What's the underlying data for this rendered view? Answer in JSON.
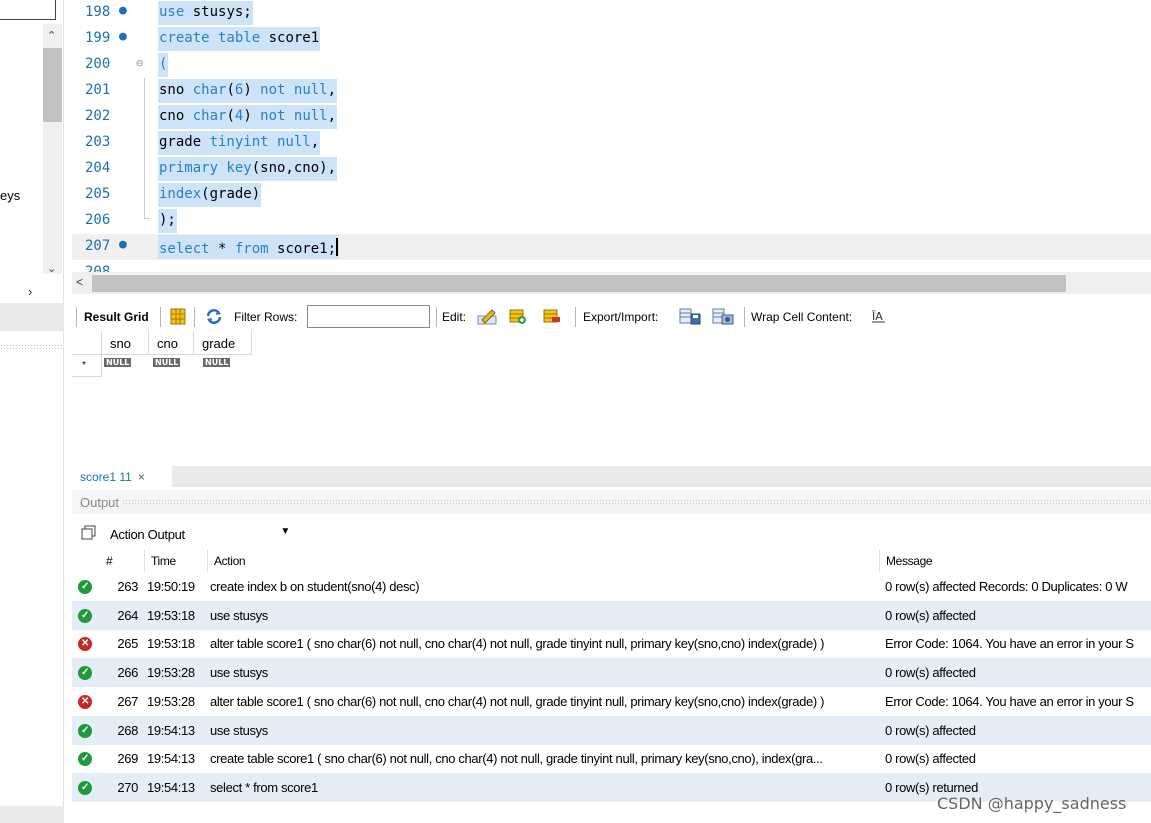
{
  "left_panel": {
    "partial_label": "eys",
    "expand_arrow": "›"
  },
  "editor": {
    "lines": [
      {
        "num": "198",
        "marker": "●",
        "fold": "",
        "code": [
          {
            "t": "use",
            "k": true
          },
          {
            "t": " stusys;",
            "k": false
          }
        ]
      },
      {
        "num": "199",
        "marker": "●",
        "fold": "",
        "code": [
          {
            "t": "create table",
            "k": true
          },
          {
            "t": " score1",
            "k": false
          }
        ]
      },
      {
        "num": "200",
        "marker": "",
        "fold": "⊖",
        "code": [
          {
            "t": "(",
            "k": true
          }
        ]
      },
      {
        "num": "201",
        "marker": "",
        "fold": "",
        "code": [
          {
            "t": "sno ",
            "k": false
          },
          {
            "t": "char",
            "k": true
          },
          {
            "t": "(",
            "k": false
          },
          {
            "t": "6",
            "k": true
          },
          {
            "t": ") ",
            "k": false
          },
          {
            "t": "not null",
            "k": true
          },
          {
            "t": ",",
            "k": false
          }
        ]
      },
      {
        "num": "202",
        "marker": "",
        "fold": "",
        "code": [
          {
            "t": "cno ",
            "k": false
          },
          {
            "t": "char",
            "k": true
          },
          {
            "t": "(",
            "k": false
          },
          {
            "t": "4",
            "k": true
          },
          {
            "t": ") ",
            "k": false
          },
          {
            "t": "not null",
            "k": true
          },
          {
            "t": ",",
            "k": false
          }
        ]
      },
      {
        "num": "203",
        "marker": "",
        "fold": "",
        "code": [
          {
            "t": "grade ",
            "k": false
          },
          {
            "t": "tinyint null",
            "k": true
          },
          {
            "t": ",",
            "k": false
          }
        ]
      },
      {
        "num": "204",
        "marker": "",
        "fold": "",
        "code": [
          {
            "t": "primary key",
            "k": true
          },
          {
            "t": "(sno,cno),",
            "k": false
          }
        ]
      },
      {
        "num": "205",
        "marker": "",
        "fold": "",
        "code": [
          {
            "t": "index",
            "k": true
          },
          {
            "t": "(grade)",
            "k": false
          }
        ]
      },
      {
        "num": "206",
        "marker": "",
        "fold": "",
        "code": [
          {
            "t": ");",
            "k": false
          }
        ]
      },
      {
        "num": "207",
        "marker": "●",
        "fold": "",
        "code": [
          {
            "t": "select",
            "k": true
          },
          {
            "t": " * ",
            "k": false
          },
          {
            "t": "from",
            "k": true
          },
          {
            "t": " score1;",
            "k": false
          }
        ]
      }
    ],
    "partial_next": "208"
  },
  "result_toolbar": {
    "result_grid": "Result Grid",
    "filter_rows": "Filter Rows:",
    "filter_value": "",
    "edit": "Edit:",
    "export_import": "Export/Import:",
    "wrap": "Wrap Cell Content:"
  },
  "grid": {
    "columns": [
      "sno",
      "cno",
      "grade"
    ],
    "null_label": "NULL",
    "new_row_marker": "*"
  },
  "result_tab": {
    "label": "score1 11",
    "close": "×"
  },
  "output": {
    "title": "Output",
    "selector": "Action Output",
    "headers": {
      "num": "#",
      "time": "Time",
      "action": "Action",
      "message": "Message"
    },
    "rows": [
      {
        "status": "ok",
        "num": "263",
        "time": "19:50:19",
        "action": "create index b on student(sno(4) desc)",
        "message": "0 row(s) affected Records: 0  Duplicates: 0  W"
      },
      {
        "status": "ok",
        "num": "264",
        "time": "19:53:18",
        "action": "use stusys",
        "message": "0 row(s) affected"
      },
      {
        "status": "err",
        "num": "265",
        "time": "19:53:18",
        "action": "alter table score1 ( sno char(6) not null, cno char(4) not null, grade tinyint null, primary key(sno,cno) index(grade) )",
        "message": "Error Code: 1064. You have an error in your S"
      },
      {
        "status": "ok",
        "num": "266",
        "time": "19:53:28",
        "action": "use stusys",
        "message": "0 row(s) affected"
      },
      {
        "status": "err",
        "num": "267",
        "time": "19:53:28",
        "action": "alter table score1 ( sno char(6) not null, cno char(4) not null, grade tinyint null, primary key(sno,cno) index(grade) )",
        "message": "Error Code: 1064. You have an error in your S"
      },
      {
        "status": "ok",
        "num": "268",
        "time": "19:54:13",
        "action": "use stusys",
        "message": "0 row(s) affected"
      },
      {
        "status": "ok",
        "num": "269",
        "time": "19:54:13",
        "action": "create table score1 ( sno char(6) not null, cno char(4) not null, grade tinyint null, primary key(sno,cno), index(gra...",
        "message": "0 row(s) affected"
      },
      {
        "status": "ok",
        "num": "270",
        "time": "19:54:13",
        "action": "select * from score1",
        "message": "0 row(s) returned"
      }
    ]
  },
  "watermark": "CSDN @happy_sadness",
  "colors": {
    "keyword": "#2d7fc5",
    "selection": "#cde3f7",
    "ok": "#1e9a3c",
    "error": "#c8272a",
    "alt_row": "#e5edf6"
  }
}
